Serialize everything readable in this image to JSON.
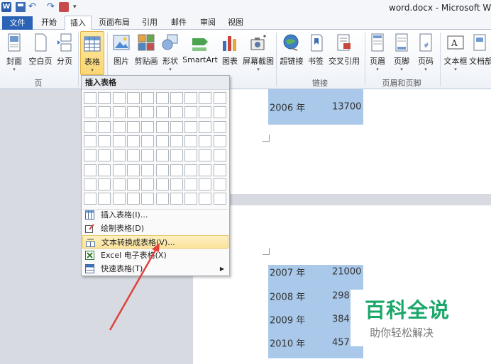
{
  "title": "word.docx - Microsoft Wo",
  "tabs": [
    "文件",
    "开始",
    "插入",
    "页面布局",
    "引用",
    "邮件",
    "审阅",
    "视图"
  ],
  "active_tab": "插入",
  "ribbon": {
    "buttons": [
      {
        "label": "封面",
        "dropdown": true
      },
      {
        "label": "空白页",
        "dropdown": false
      },
      {
        "label": "分页",
        "dropdown": false
      },
      {
        "label": "表格",
        "dropdown": true
      },
      {
        "label": "图片",
        "dropdown": false
      },
      {
        "label": "剪贴画",
        "dropdown": false
      },
      {
        "label": "形状",
        "dropdown": true
      },
      {
        "label": "SmartArt",
        "dropdown": false
      },
      {
        "label": "图表",
        "dropdown": false
      },
      {
        "label": "屏幕截图",
        "dropdown": true
      },
      {
        "label": "超链接",
        "dropdown": false
      },
      {
        "label": "书签",
        "dropdown": false
      },
      {
        "label": "交叉引用",
        "dropdown": false
      },
      {
        "label": "页眉",
        "dropdown": true
      },
      {
        "label": "页脚",
        "dropdown": true
      },
      {
        "label": "页码",
        "dropdown": true
      },
      {
        "label": "文本框",
        "dropdown": true
      },
      {
        "label": "文档部",
        "dropdown": false
      }
    ],
    "groups": [
      "页",
      "链接",
      "页眉和页脚"
    ]
  },
  "dropdown": {
    "header": "插入表格",
    "items": [
      {
        "label": "插入表格(I)..."
      },
      {
        "label": "绘制表格(D)"
      },
      {
        "label": "文本转换成表格(V)..."
      },
      {
        "label": "Excel 电子表格(X)"
      },
      {
        "label": "快速表格(T)"
      }
    ]
  },
  "document": {
    "page1_rows": [
      {
        "year": "2006 年",
        "value": "13700"
      }
    ],
    "page2_rows": [
      {
        "year": "2007 年",
        "value": "21000"
      },
      {
        "year": "2008 年",
        "value": "2980"
      },
      {
        "year": "2009 年",
        "value": "3840"
      },
      {
        "year": "2010 年",
        "value": "4573"
      }
    ]
  },
  "watermark": {
    "title": "百科全说",
    "subtitle": "助你轻松解决"
  },
  "colors": {
    "accent": "#2a62b6",
    "highlight": "#a9c8ea",
    "menu_hover": "#fbe39a",
    "arrow": "#e0413c",
    "watermark": "#1aa86a"
  }
}
